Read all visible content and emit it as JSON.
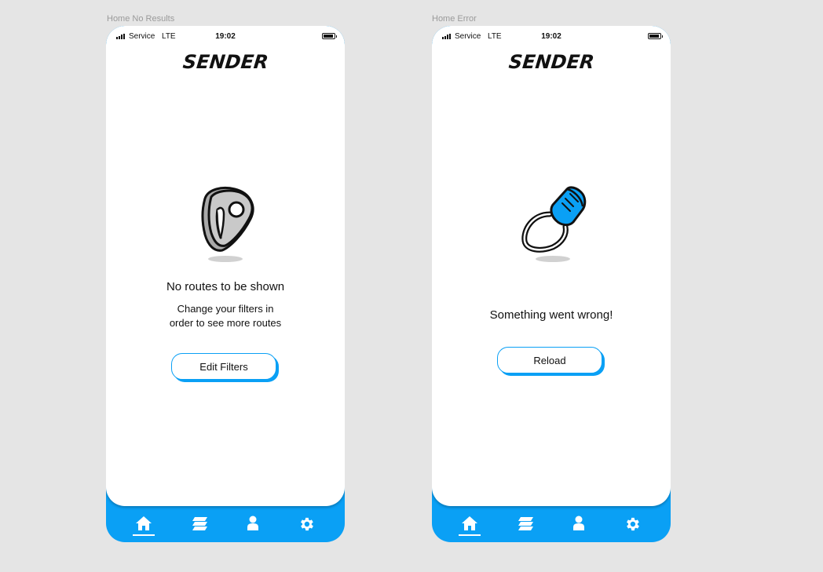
{
  "frames": [
    {
      "label": "Home No Results",
      "status": {
        "carrier": "Service",
        "network": "LTE",
        "time": "19:02"
      },
      "logo_text": "SENDER",
      "illustration_icon": "belay-device-icon",
      "title": "No routes to be shown",
      "body_lines": [
        "Change your filters in",
        "order to see more routes"
      ],
      "button_label": "Edit Filters",
      "tabs": [
        {
          "name": "home-tab",
          "icon": "home-icon",
          "active": true
        },
        {
          "name": "routes-tab",
          "icon": "layers-icon",
          "active": false
        },
        {
          "name": "profile-tab",
          "icon": "user-icon",
          "active": false
        },
        {
          "name": "settings-tab",
          "icon": "gear-icon",
          "active": false
        }
      ]
    },
    {
      "label": "Home Error",
      "status": {
        "carrier": "Service",
        "network": "LTE",
        "time": "19:02"
      },
      "logo_text": "SENDER",
      "illustration_icon": "climbing-hold-ring-icon",
      "title": "Something went wrong!",
      "button_label": "Reload",
      "tabs": [
        {
          "name": "home-tab",
          "icon": "home-icon",
          "active": true
        },
        {
          "name": "routes-tab",
          "icon": "layers-icon",
          "active": false
        },
        {
          "name": "profile-tab",
          "icon": "user-icon",
          "active": false
        },
        {
          "name": "settings-tab",
          "icon": "gear-icon",
          "active": false
        }
      ]
    }
  ],
  "colors": {
    "accent": "#0aa0f5",
    "background": "#e5e5e5",
    "screen": "#ffffff",
    "text": "#111111"
  }
}
